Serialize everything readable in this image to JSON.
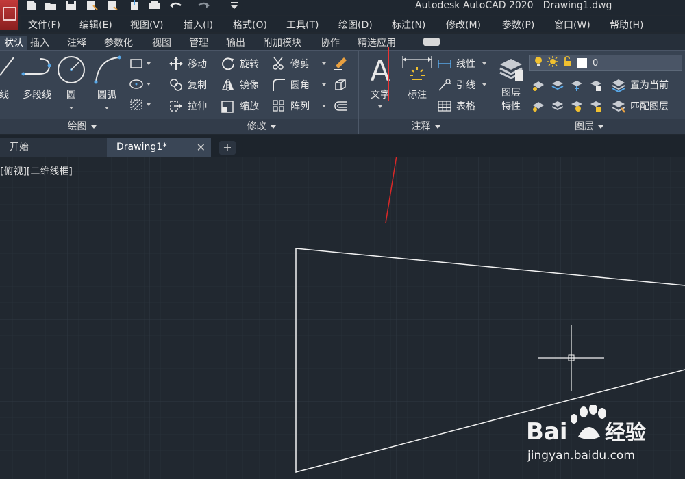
{
  "window": {
    "app_name": "Autodesk AutoCAD 2020",
    "document_name": "Drawing1.dwg"
  },
  "menu": [
    "文件(F)",
    "编辑(E)",
    "视图(V)",
    "插入(I)",
    "格式(O)",
    "工具(T)",
    "绘图(D)",
    "标注(N)",
    "修改(M)",
    "参数(P)",
    "窗口(W)",
    "帮助(H)"
  ],
  "ribbon_tabs": [
    "默认",
    "插入",
    "注释",
    "参数化",
    "视图",
    "管理",
    "输出",
    "附加模块",
    "协作",
    "精选应用"
  ],
  "ribbon_tabs_visible_first": "状认",
  "panels": {
    "draw": {
      "title": "绘图",
      "tools": {
        "line": "直线",
        "polyline": "多段线",
        "circle": "圆",
        "arc": "圆弧"
      }
    },
    "modify": {
      "title": "修改",
      "tools": {
        "move": "移动",
        "rotate": "旋转",
        "trim": "修剪",
        "copy": "复制",
        "mirror": "镜像",
        "fillet": "圆角",
        "stretch": "拉伸",
        "scale": "缩放",
        "array": "阵列"
      }
    },
    "annotation": {
      "title": "注释",
      "tools": {
        "text": "文字",
        "dimension": "标注",
        "linear": "线性",
        "leader": "引线",
        "table": "表格"
      }
    },
    "layers": {
      "title": "图层",
      "tools": {
        "layer_properties_1": "图层",
        "layer_properties_2": "特性",
        "set_current": "置为当前",
        "match_layer": "匹配图层"
      },
      "current_layer": "0"
    }
  },
  "file_tabs": {
    "start": "开始",
    "drawing": "Drawing1*",
    "new_tab": "+"
  },
  "viewport_label": "[俯视][二维线框]",
  "watermark": {
    "logo_text": "Bai经验",
    "url": "jingyan.baidu.com"
  },
  "colors": {
    "accent_highlight": "#e33333",
    "canvas": "#212830",
    "ribbon": "#384352"
  }
}
